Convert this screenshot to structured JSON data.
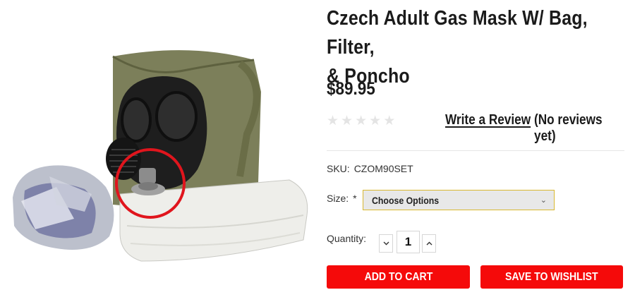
{
  "product": {
    "title_line1": "Czech Adult Gas Mask W/ Bag, Filter,",
    "title_line2": "& Poncho",
    "price": "$89.95",
    "rating_stars": 0,
    "write_review": "Write a Review",
    "review_count": "(No reviews yet)",
    "sku_label": "SKU:",
    "sku_value": "CZOM90SET",
    "size_label": "Size:",
    "required_mark": "*",
    "size_selected": "Choose Options",
    "quantity_label": "Quantity:",
    "quantity_value": "1",
    "add_to_cart": "ADD TO CART",
    "save_to_wishlist": "SAVE TO WISHLIST"
  },
  "colors": {
    "button": "#f50a0a",
    "select_border": "#d8b830",
    "highlight_circle": "#e0151d"
  },
  "icons": {
    "star": "star-icon",
    "select": "chevron-down-icon",
    "decrement": "chevron-down-icon",
    "increment": "chevron-up-icon"
  }
}
